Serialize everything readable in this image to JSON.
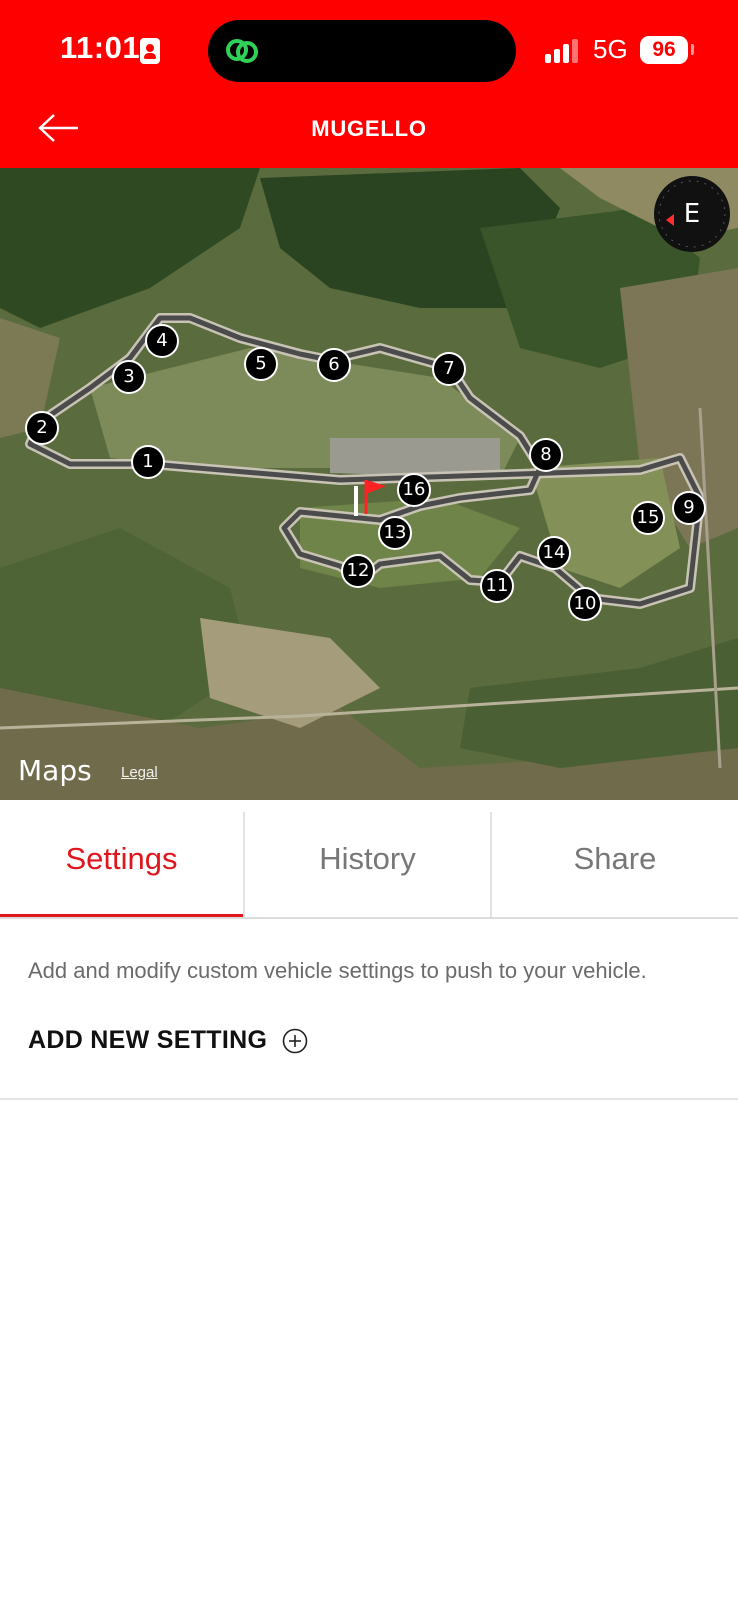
{
  "status_bar": {
    "time": "11:01",
    "network": "5G",
    "battery": "96"
  },
  "header": {
    "title": "MUGELLO",
    "background_color": "#ff0000"
  },
  "map": {
    "provider": "Maps",
    "legal": "Legal",
    "compass": "E",
    "turns": [
      "1",
      "2",
      "3",
      "4",
      "5",
      "6",
      "7",
      "8",
      "9",
      "10",
      "11",
      "12",
      "13",
      "14",
      "15",
      "16"
    ]
  },
  "tabs": [
    {
      "label": "Settings",
      "active": true
    },
    {
      "label": "History",
      "active": false
    },
    {
      "label": "Share",
      "active": false
    }
  ],
  "settings": {
    "description": "Add and modify custom vehicle settings to push to your vehicle.",
    "add_label": "ADD NEW SETTING"
  },
  "colors": {
    "accent": "#e0161d",
    "brand": "#ff0000"
  },
  "icons": {
    "back": "arrow-left-icon",
    "compass": "compass-icon",
    "add": "plus-circle-icon",
    "apple": "apple-icon"
  }
}
